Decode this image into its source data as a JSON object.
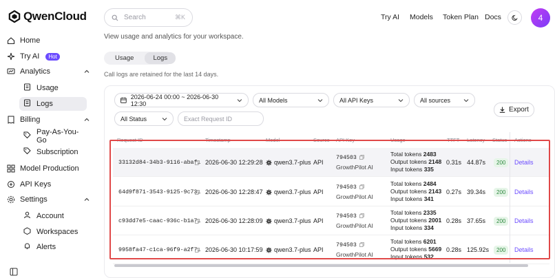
{
  "brand": {
    "name": "QwenCloud"
  },
  "sidebar": {
    "items": [
      {
        "label": "Home",
        "icon": "home-icon"
      },
      {
        "label": "Try AI",
        "icon": "sparkle-icon",
        "badge": "Hot"
      },
      {
        "label": "Analytics",
        "icon": "chart-icon",
        "expanded": true,
        "children": [
          {
            "label": "Usage",
            "icon": "doc-icon"
          },
          {
            "label": "Logs",
            "icon": "doc-icon",
            "active": true
          }
        ]
      },
      {
        "label": "Billing",
        "icon": "receipt-icon",
        "expanded": true,
        "children": [
          {
            "label": "Pay-As-You-Go",
            "icon": "tag-icon"
          },
          {
            "label": "Subscription",
            "icon": "tag-icon"
          }
        ]
      },
      {
        "label": "Model Production",
        "icon": "grid-icon"
      },
      {
        "label": "API Keys",
        "icon": "key-icon"
      },
      {
        "label": "Settings",
        "icon": "gear-icon",
        "expanded": true,
        "children": [
          {
            "label": "Account",
            "icon": "user-icon"
          },
          {
            "label": "Workspaces",
            "icon": "box-icon"
          },
          {
            "label": "Alerts",
            "icon": "bell-icon"
          }
        ]
      }
    ]
  },
  "header": {
    "search_placeholder": "Search",
    "search_shortcut": "⌘K",
    "nav": [
      "Try AI",
      "Models",
      "Token Plan",
      "Docs"
    ],
    "avatar_initial": "4"
  },
  "page": {
    "subtitle": "View usage and analytics for your workspace.",
    "tabs": [
      "Usage",
      "Logs"
    ],
    "active_tab": "Logs",
    "retention_note": "Call logs are retained for the last 14 days."
  },
  "filters": {
    "date_range": "2026-06-24 00:00 ~ 2026-06-30 12:30",
    "models": "All Models",
    "api_keys": "All API Keys",
    "sources": "All sources",
    "status": "All Status",
    "request_id_placeholder": "Exact Request ID",
    "export_label": "Export"
  },
  "table": {
    "columns": [
      "Request ID",
      "Timestamp",
      "Model",
      "Source",
      "API Key",
      "Usage",
      "TTFT",
      "Latency",
      "Status",
      "Actions"
    ],
    "labels": {
      "total": "Total tokens",
      "output": "Output tokens",
      "input": "Input tokens",
      "details": "Details"
    },
    "rows": [
      {
        "request_id": "33132d84-34b3-9116-abaf…",
        "timestamp": "2026-06-30 12:29:28",
        "model": "qwen3.7-plus",
        "source": "API",
        "api_key": "794503",
        "key_name": "GrowthPilot AI",
        "total": "2483",
        "output": "2148",
        "input": "335",
        "ttft": "0.31s",
        "latency": "44.87s",
        "status": "200"
      },
      {
        "request_id": "64d9f871-3543-9125-9c73…",
        "timestamp": "2026-06-30 12:28:47",
        "model": "qwen3.7-plus",
        "source": "API",
        "api_key": "794503",
        "key_name": "GrowthPilot AI",
        "total": "2484",
        "output": "2143",
        "input": "341",
        "ttft": "0.27s",
        "latency": "39.34s",
        "status": "200"
      },
      {
        "request_id": "c93dd7e5-caac-936c-b1a7…",
        "timestamp": "2026-06-30 12:28:09",
        "model": "qwen3.7-plus",
        "source": "API",
        "api_key": "794503",
        "key_name": "GrowthPilot AI",
        "total": "2335",
        "output": "2001",
        "input": "334",
        "ttft": "0.28s",
        "latency": "37.65s",
        "status": "200"
      },
      {
        "request_id": "9958fa47-c1ca-96f9-a2f7…",
        "timestamp": "2026-06-30 10:17:59",
        "model": "qwen3.7-plus",
        "source": "API",
        "api_key": "794503",
        "key_name": "GrowthPilot AI",
        "total": "6201",
        "output": "5669",
        "input": "532",
        "ttft": "0.28s",
        "latency": "125.92s",
        "status": "200"
      }
    ]
  },
  "colors": {
    "accent": "#6b4bff",
    "highlight": "#e04848",
    "status_ok": "#2e8a3f"
  }
}
